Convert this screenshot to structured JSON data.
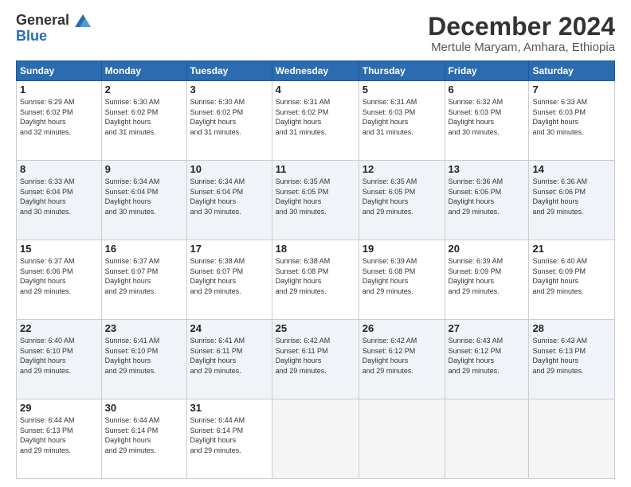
{
  "logo": {
    "line1": "General",
    "line2": "Blue"
  },
  "title": "December 2024",
  "subtitle": "Mertule Maryam, Amhara, Ethiopia",
  "days_header": [
    "Sunday",
    "Monday",
    "Tuesday",
    "Wednesday",
    "Thursday",
    "Friday",
    "Saturday"
  ],
  "weeks": [
    [
      {
        "day": "1",
        "sunrise": "6:29 AM",
        "sunset": "6:02 PM",
        "daylight": "11 hours and 32 minutes."
      },
      {
        "day": "2",
        "sunrise": "6:30 AM",
        "sunset": "6:02 PM",
        "daylight": "11 hours and 31 minutes."
      },
      {
        "day": "3",
        "sunrise": "6:30 AM",
        "sunset": "6:02 PM",
        "daylight": "11 hours and 31 minutes."
      },
      {
        "day": "4",
        "sunrise": "6:31 AM",
        "sunset": "6:02 PM",
        "daylight": "11 hours and 31 minutes."
      },
      {
        "day": "5",
        "sunrise": "6:31 AM",
        "sunset": "6:03 PM",
        "daylight": "11 hours and 31 minutes."
      },
      {
        "day": "6",
        "sunrise": "6:32 AM",
        "sunset": "6:03 PM",
        "daylight": "11 hours and 30 minutes."
      },
      {
        "day": "7",
        "sunrise": "6:33 AM",
        "sunset": "6:03 PM",
        "daylight": "11 hours and 30 minutes."
      }
    ],
    [
      {
        "day": "8",
        "sunrise": "6:33 AM",
        "sunset": "6:04 PM",
        "daylight": "11 hours and 30 minutes."
      },
      {
        "day": "9",
        "sunrise": "6:34 AM",
        "sunset": "6:04 PM",
        "daylight": "11 hours and 30 minutes."
      },
      {
        "day": "10",
        "sunrise": "6:34 AM",
        "sunset": "6:04 PM",
        "daylight": "11 hours and 30 minutes."
      },
      {
        "day": "11",
        "sunrise": "6:35 AM",
        "sunset": "6:05 PM",
        "daylight": "11 hours and 30 minutes."
      },
      {
        "day": "12",
        "sunrise": "6:35 AM",
        "sunset": "6:05 PM",
        "daylight": "11 hours and 29 minutes."
      },
      {
        "day": "13",
        "sunrise": "6:36 AM",
        "sunset": "6:06 PM",
        "daylight": "11 hours and 29 minutes."
      },
      {
        "day": "14",
        "sunrise": "6:36 AM",
        "sunset": "6:06 PM",
        "daylight": "11 hours and 29 minutes."
      }
    ],
    [
      {
        "day": "15",
        "sunrise": "6:37 AM",
        "sunset": "6:06 PM",
        "daylight": "11 hours and 29 minutes."
      },
      {
        "day": "16",
        "sunrise": "6:37 AM",
        "sunset": "6:07 PM",
        "daylight": "11 hours and 29 minutes."
      },
      {
        "day": "17",
        "sunrise": "6:38 AM",
        "sunset": "6:07 PM",
        "daylight": "11 hours and 29 minutes."
      },
      {
        "day": "18",
        "sunrise": "6:38 AM",
        "sunset": "6:08 PM",
        "daylight": "11 hours and 29 minutes."
      },
      {
        "day": "19",
        "sunrise": "6:39 AM",
        "sunset": "6:08 PM",
        "daylight": "11 hours and 29 minutes."
      },
      {
        "day": "20",
        "sunrise": "6:39 AM",
        "sunset": "6:09 PM",
        "daylight": "11 hours and 29 minutes."
      },
      {
        "day": "21",
        "sunrise": "6:40 AM",
        "sunset": "6:09 PM",
        "daylight": "11 hours and 29 minutes."
      }
    ],
    [
      {
        "day": "22",
        "sunrise": "6:40 AM",
        "sunset": "6:10 PM",
        "daylight": "11 hours and 29 minutes."
      },
      {
        "day": "23",
        "sunrise": "6:41 AM",
        "sunset": "6:10 PM",
        "daylight": "11 hours and 29 minutes."
      },
      {
        "day": "24",
        "sunrise": "6:41 AM",
        "sunset": "6:11 PM",
        "daylight": "11 hours and 29 minutes."
      },
      {
        "day": "25",
        "sunrise": "6:42 AM",
        "sunset": "6:11 PM",
        "daylight": "11 hours and 29 minutes."
      },
      {
        "day": "26",
        "sunrise": "6:42 AM",
        "sunset": "6:12 PM",
        "daylight": "11 hours and 29 minutes."
      },
      {
        "day": "27",
        "sunrise": "6:43 AM",
        "sunset": "6:12 PM",
        "daylight": "11 hours and 29 minutes."
      },
      {
        "day": "28",
        "sunrise": "6:43 AM",
        "sunset": "6:13 PM",
        "daylight": "11 hours and 29 minutes."
      }
    ],
    [
      {
        "day": "29",
        "sunrise": "6:44 AM",
        "sunset": "6:13 PM",
        "daylight": "11 hours and 29 minutes."
      },
      {
        "day": "30",
        "sunrise": "6:44 AM",
        "sunset": "6:14 PM",
        "daylight": "11 hours and 29 minutes."
      },
      {
        "day": "31",
        "sunrise": "6:44 AM",
        "sunset": "6:14 PM",
        "daylight": "11 hours and 29 minutes."
      },
      null,
      null,
      null,
      null
    ]
  ]
}
